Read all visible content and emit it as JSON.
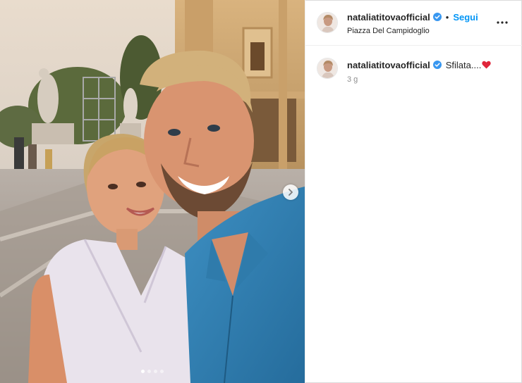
{
  "post": {
    "username": "nataliatitovaofficial",
    "verified": true,
    "follow_label": "Segui",
    "separator": "•",
    "location": "Piazza Del Campidoglio",
    "more_icon": "more-horizontal-icon"
  },
  "caption": {
    "username": "nataliatitovaofficial",
    "text": "Sfilata....",
    "emoji": "red-heart-icon",
    "time": "3 g"
  },
  "carousel": {
    "total_slides": 4,
    "active_slide": 1,
    "next_icon": "chevron-right-icon"
  },
  "colors": {
    "accent": "#0095f6",
    "verified": "#3897f0",
    "heart": "#e0263b"
  }
}
